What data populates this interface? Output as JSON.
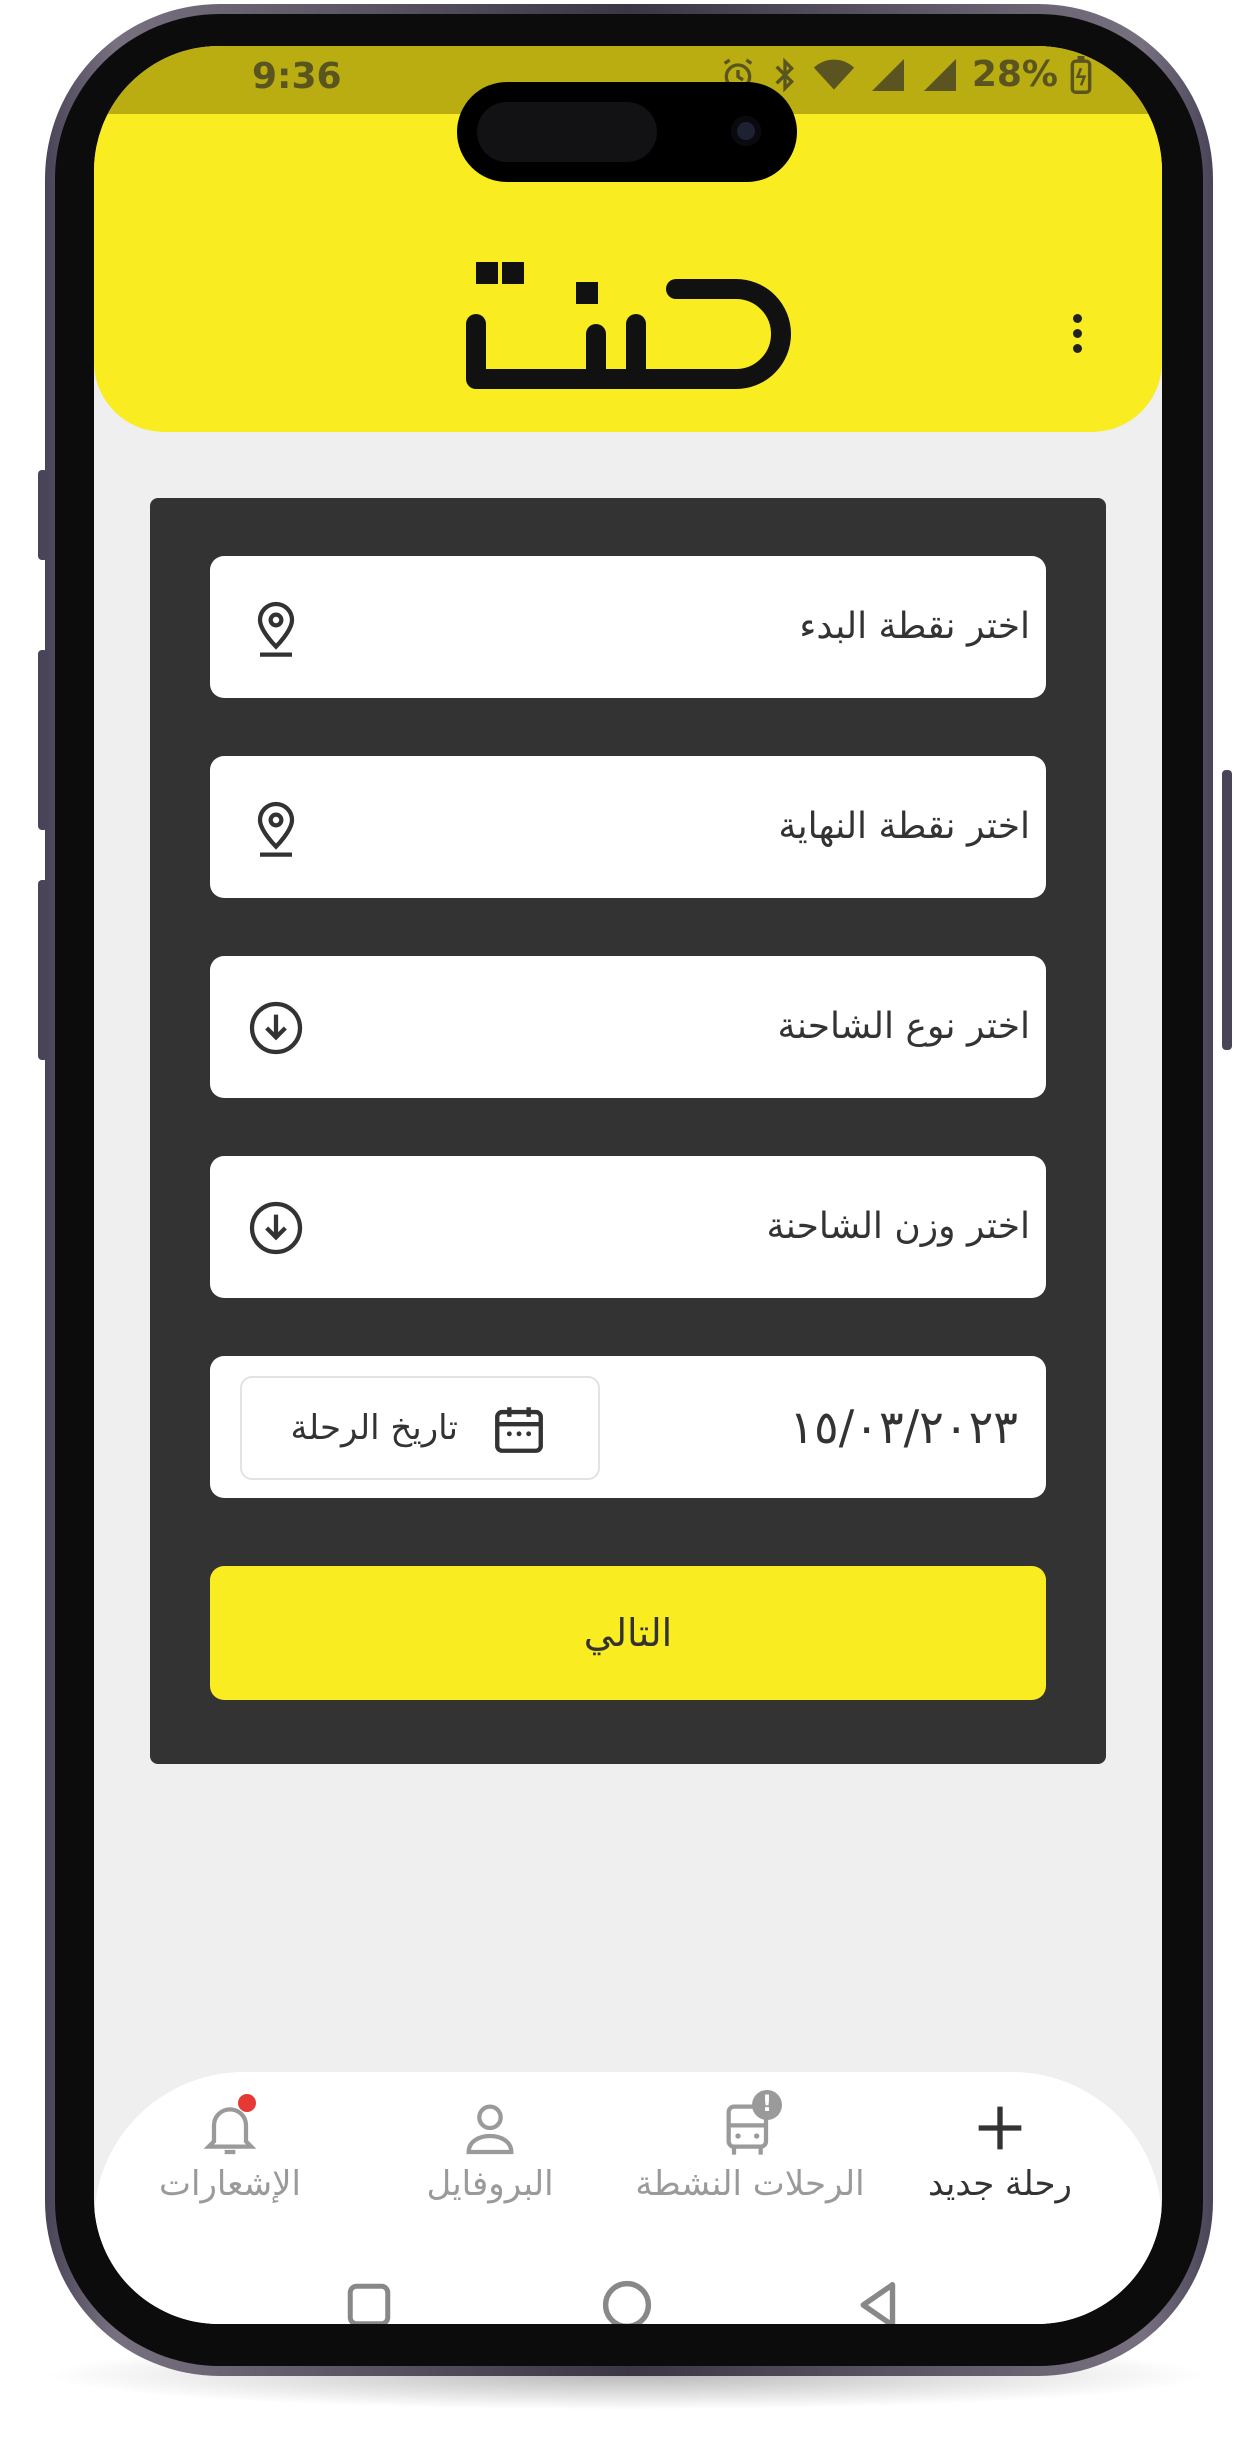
{
  "status_bar": {
    "time": "9:36",
    "battery": "28%"
  },
  "app": {
    "logo_alt": "دلنا"
  },
  "form": {
    "start_point_placeholder": "اختر نقطة البدء",
    "end_point_placeholder": "اختر نقطة النهاية",
    "truck_type_placeholder": "اختر نوع الشاحنة",
    "truck_weight_placeholder": "اختر وزن الشاحنة",
    "trip_date_label": "تاريخ الرحلة",
    "trip_date_value": "١٥/٠٣/٢٠٢٣",
    "next_button": "التالي"
  },
  "bottom_nav": {
    "items": [
      {
        "label": "رحلة جديد",
        "icon": "plus-icon",
        "active": true
      },
      {
        "label": "الرحلات النشطة",
        "icon": "bus-icon",
        "badge": "!"
      },
      {
        "label": "البروفايل",
        "icon": "user-icon"
      },
      {
        "label": "الإشعارات",
        "icon": "bell-icon",
        "dot": true
      }
    ]
  },
  "colors": {
    "brand_yellow": "#f9ec21",
    "card": "#333333",
    "notification_dot": "#e53935"
  }
}
